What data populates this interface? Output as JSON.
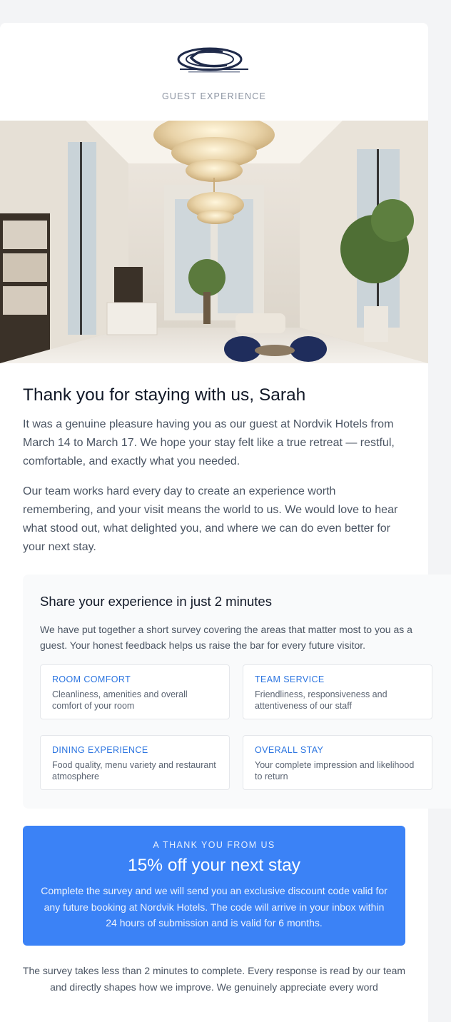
{
  "header": {
    "logo_name": "company-logo",
    "eyebrow": "GUEST EXPERIENCE"
  },
  "hero": {
    "image_name": "hotel-lobby-photo"
  },
  "intro": {
    "title": "Thank you for staying with us, Sarah",
    "paragraph1": "It was a genuine pleasure having you as our guest at Nordvik Hotels from March 14 to March 17. We hope your stay felt like a true retreat — restful, comfortable, and exactly what you needed.",
    "paragraph2": "Our team works hard every day to create an experience worth remembering, and your visit means the world to us. We would love to hear what stood out, what delighted you, and where we can do even better for your next stay."
  },
  "survey": {
    "title": "Share your experience in just 2 minutes",
    "text": "We have put together a short survey covering the areas that matter most to you as a guest. Your honest feedback helps us raise the bar for every future visitor.",
    "tiles": [
      {
        "title": "ROOM COMFORT",
        "desc": "Cleanliness, amenities and overall comfort of your room"
      },
      {
        "title": "TEAM SERVICE",
        "desc": "Friendliness, responsiveness and attentiveness of our staff"
      },
      {
        "title": "DINING EXPERIENCE",
        "desc": "Food quality, menu variety and restaurant atmosphere"
      },
      {
        "title": "OVERALL STAY",
        "desc": "Your complete impression and likelihood to return"
      }
    ]
  },
  "offer": {
    "eyebrow": "A THANK YOU FROM US",
    "title": "15% off your next stay",
    "text": "Complete the survey and we will send you an exclusive discount code valid for any future booking at Nordvik Hotels. The code will arrive in your inbox within 24 hours of submission and is valid for 6 months."
  },
  "footer": {
    "note": "The survey takes less than 2 minutes to complete. Every response is read by our team and directly shapes how we improve. We genuinely appreciate every word"
  },
  "colors": {
    "accent": "#3b82f6",
    "tile_title": "#2b74e0",
    "background": "#f3f4f6"
  }
}
